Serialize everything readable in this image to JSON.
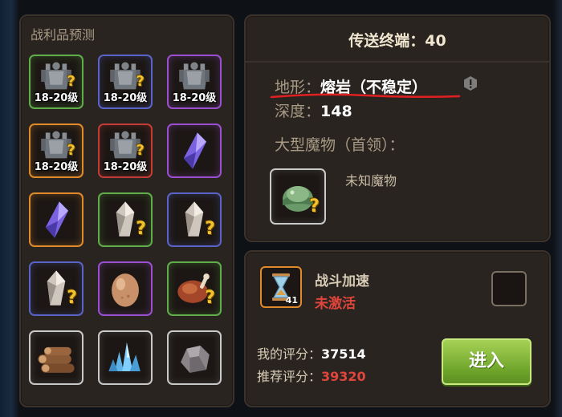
{
  "loot": {
    "title": "战利品预测",
    "slots": [
      {
        "rarity": "green",
        "icon": "armor-set-icon",
        "level": "18-20级",
        "unknown": true
      },
      {
        "rarity": "blue",
        "icon": "armor-set-icon",
        "level": "18-20级",
        "unknown": true
      },
      {
        "rarity": "purple",
        "icon": "armor-set-icon",
        "level": "18-20级",
        "unknown": false
      },
      {
        "rarity": "orange",
        "icon": "armor-set-icon",
        "level": "18-20级",
        "unknown": true
      },
      {
        "rarity": "red",
        "icon": "armor-set-icon",
        "level": "18-20级",
        "unknown": true
      },
      {
        "rarity": "purple",
        "icon": "purple-crystal-icon",
        "level": "",
        "unknown": false
      },
      {
        "rarity": "orange",
        "icon": "purple-crystal-icon",
        "level": "",
        "unknown": false
      },
      {
        "rarity": "green",
        "icon": "white-crystal-icon",
        "level": "",
        "unknown": true
      },
      {
        "rarity": "blue",
        "icon": "white-crystal-icon",
        "level": "",
        "unknown": true
      },
      {
        "rarity": "blue",
        "icon": "white-crystal-icon",
        "level": "",
        "unknown": true
      },
      {
        "rarity": "purple",
        "icon": "egg-icon",
        "level": "",
        "unknown": false
      },
      {
        "rarity": "green",
        "icon": "roast-meat-icon",
        "level": "",
        "unknown": true
      },
      {
        "rarity": "white",
        "icon": "wood-logs-icon",
        "level": "",
        "unknown": false
      },
      {
        "rarity": "white",
        "icon": "blue-crystal-cluster-icon",
        "level": "",
        "unknown": false
      },
      {
        "rarity": "white",
        "icon": "stone-ore-icon",
        "level": "",
        "unknown": false
      }
    ],
    "question_mark": "?"
  },
  "portal": {
    "title": "传送终端：40",
    "terrain_label": "地形：",
    "terrain_value": "熔岩（不稳定）",
    "depth_label": "深度：",
    "depth_value": "148",
    "boss_label": "大型魔物（首领）：",
    "boss_name": "未知魔物",
    "boss_icon": "helmet-unknown-icon"
  },
  "battle": {
    "speed_label": "战斗加速",
    "speed_status": "未激活",
    "speed_count": "41",
    "speed_icon": "hourglass-icon",
    "my_score_label": "我的评分：",
    "my_score": "37514",
    "rec_score_label": "推荐评分：",
    "rec_score": "39320",
    "enter_label": "进入"
  },
  "colors": {
    "panel": "#2a2420",
    "warning_red": "#e0453c",
    "enter_green": "#7fb838",
    "rarity": {
      "green": "#5fae4a",
      "blue": "#5a63c8",
      "purple": "#9a4fd0",
      "orange": "#e08a2c",
      "red": "#c33c35",
      "white": "#c9c9c9"
    }
  }
}
